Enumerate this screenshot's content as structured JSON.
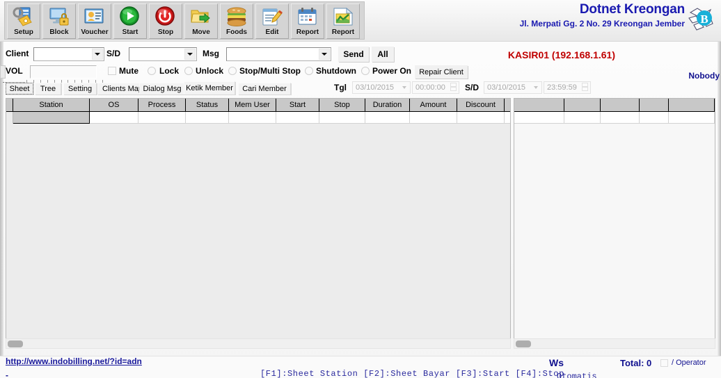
{
  "toolbar": {
    "buttons": [
      {
        "label": "Setup",
        "icon": "setup-icon"
      },
      {
        "label": "Block",
        "icon": "block-icon"
      },
      {
        "label": "Voucher",
        "icon": "voucher-icon"
      },
      {
        "label": "Start",
        "icon": "start-icon"
      },
      {
        "label": "Stop",
        "icon": "stop-icon"
      },
      {
        "label": "Move",
        "icon": "move-icon"
      },
      {
        "label": "Foods",
        "icon": "foods-icon"
      },
      {
        "label": "Edit",
        "icon": "edit-icon"
      },
      {
        "label": "Report",
        "icon": "report-calendar-icon"
      },
      {
        "label": "Report",
        "icon": "report-chart-icon"
      }
    ]
  },
  "brand": {
    "title": "Dotnet Kreongan",
    "address": "Jl. Merpati Gg. 2 No. 29 Kreongan Jember",
    "logo": "globe-b-logo"
  },
  "controls": {
    "client_label": "Client",
    "client_value": "",
    "sd_label": "S/D",
    "sd_value": "",
    "msg_label": "Msg",
    "msg_value": "",
    "send_label": "Send",
    "all_label": "All",
    "vol_label": "VOL",
    "mute_label": "Mute",
    "lock_label": "Lock",
    "unlock_label": "Unlock",
    "stop_multi_label": "Stop/Multi Stop",
    "shutdown_label": "Shutdown",
    "power_on_label": "Power On",
    "repair_client_label": "Repair Client",
    "kasir_label": "KASIR01 (192.168.1.61)",
    "nobody_label": "Nobody"
  },
  "tabs": [
    {
      "label": "Sheet",
      "selected": true
    },
    {
      "label": "Tree",
      "selected": false
    },
    {
      "label": "Setting",
      "selected": false
    },
    {
      "label": "Clients Map",
      "selected": false
    },
    {
      "label": "Dialog Msg",
      "selected": false
    },
    {
      "label": "Ketik Member",
      "selected": false
    },
    {
      "label": "Cari Member",
      "selected": false
    }
  ],
  "daterange": {
    "tgl_label": "Tgl",
    "date_from": "03/10/2015",
    "time_from": "00:00:00",
    "sd_label": "S/D",
    "date_to": "03/10/2015",
    "time_to": "23:59:59"
  },
  "grid_left": {
    "columns": [
      "Station",
      "OS",
      "Process",
      "Status",
      "Mem User",
      "Start",
      "Stop",
      "Duration",
      "Amount",
      "Discount",
      ""
    ],
    "rows": []
  },
  "grid_right": {
    "columns": [
      "",
      "",
      "",
      "",
      ""
    ],
    "rows": []
  },
  "status": {
    "url": "http://www.indobilling.net/?id=adn",
    "dash": "-",
    "fkeys": "[F1]:Sheet Station [F2]:Sheet Bayar [F3]:Start  [F4]:Stop",
    "ws_label": "Ws",
    "total_label": "Total: 0",
    "operator_label": "/ Operator",
    "extra": "Otomatis"
  },
  "colors": {
    "brand_blue": "#1a1ab0",
    "kasir_red": "#c00000",
    "link_blue": "#1a1a9c",
    "header_gray": "#c8c8c8"
  }
}
